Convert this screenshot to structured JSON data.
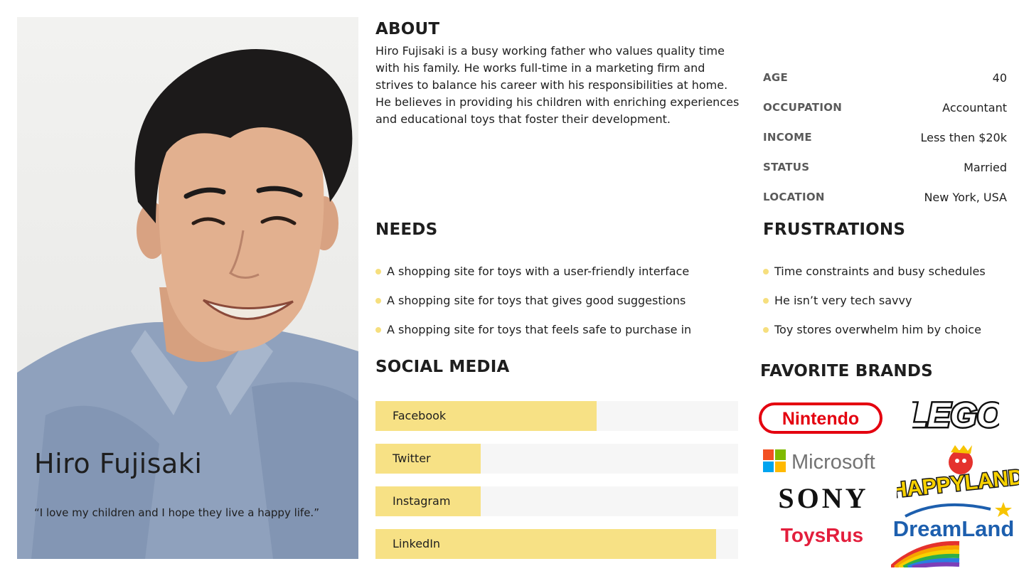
{
  "persona": {
    "name": "Hiro Fujisaki",
    "quote": "“I love my children and I hope they live a happy life.”"
  },
  "about": {
    "heading": "ABOUT",
    "text": "Hiro Fujisaki is a busy working father who values quality time with his family. He works full-time in a marketing firm and strives to balance his career with his responsibilities at home. He believes in providing his children with enriching experiences and educational toys that foster their development."
  },
  "demographics": [
    {
      "label": "AGE",
      "value": "40"
    },
    {
      "label": "OCCUPATION",
      "value": "Accountant"
    },
    {
      "label": "INCOME",
      "value": "Less then $20k"
    },
    {
      "label": "STATUS",
      "value": "Married"
    },
    {
      "label": "LOCATION",
      "value": "New York, USA"
    }
  ],
  "needs": {
    "heading": "NEEDS",
    "items": [
      "A shopping site for toys with a user-friendly interface",
      "A shopping site for toys that gives good suggestions",
      "A shopping site for toys that feels safe to purchase in"
    ]
  },
  "frustrations": {
    "heading": "FRUSTRATIONS",
    "items": [
      "Time constraints and busy schedules",
      "He isn’t very tech savvy",
      "Toy stores overwhelm him by choice"
    ]
  },
  "social_media": {
    "heading": "SOCIAL MEDIA",
    "items": [
      {
        "name": "Facebook",
        "level": 0.61
      },
      {
        "name": "Twitter",
        "level": 0.29
      },
      {
        "name": "Instagram",
        "level": 0.29
      },
      {
        "name": "LinkedIn",
        "level": 0.94
      }
    ]
  },
  "brands": {
    "heading": "FAVORITE BRANDS",
    "logos": {
      "nintendo": "Nintendo",
      "lego": "LEGO",
      "microsoft": "Microsoft",
      "happyland": "HAPPYLAND",
      "sony": "SONY",
      "toysrus": "ToysRus",
      "dreamland": "DreamLand"
    }
  },
  "colors": {
    "accent": "#f7e185",
    "nintendo": "#e4000f",
    "dreamland": "#1d5fae"
  }
}
